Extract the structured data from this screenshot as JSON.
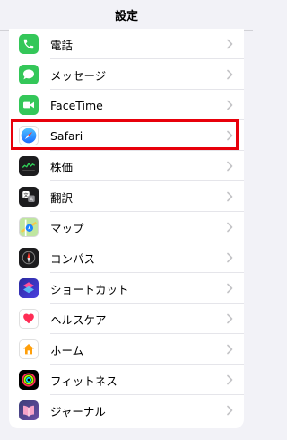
{
  "header": {
    "title": "設定"
  },
  "rows": [
    {
      "label": "電話",
      "icon": "phone-icon",
      "color": "#34c759"
    },
    {
      "label": "メッセージ",
      "icon": "messages-icon",
      "color": "#34c759"
    },
    {
      "label": "FaceTime",
      "icon": "facetime-icon",
      "color": "#34c759"
    },
    {
      "label": "Safari",
      "icon": "safari-icon",
      "color": "#1a84ff",
      "highlighted": true
    },
    {
      "label": "株価",
      "icon": "stocks-icon",
      "color": "#1c1c1e"
    },
    {
      "label": "翻訳",
      "icon": "translate-icon",
      "color": "#1c1c1e"
    },
    {
      "label": "マップ",
      "icon": "maps-icon",
      "color": "#a7dc7a"
    },
    {
      "label": "コンパス",
      "icon": "compass-icon",
      "color": "#1c1c1e"
    },
    {
      "label": "ショートカット",
      "icon": "shortcuts-icon",
      "color": "#3a3ad8"
    },
    {
      "label": "ヘルスケア",
      "icon": "health-icon",
      "color": "#ffffff"
    },
    {
      "label": "ホーム",
      "icon": "home-icon",
      "color": "#ffffff"
    },
    {
      "label": "フィットネス",
      "icon": "fitness-icon",
      "color": "#000000"
    },
    {
      "label": "ジャーナル",
      "icon": "journal-icon",
      "color": "#3c3f7a"
    }
  ],
  "colors": {
    "highlight_border": "#e8000b",
    "chevron": "#c4c4c7",
    "background": "#f2f2f7"
  }
}
